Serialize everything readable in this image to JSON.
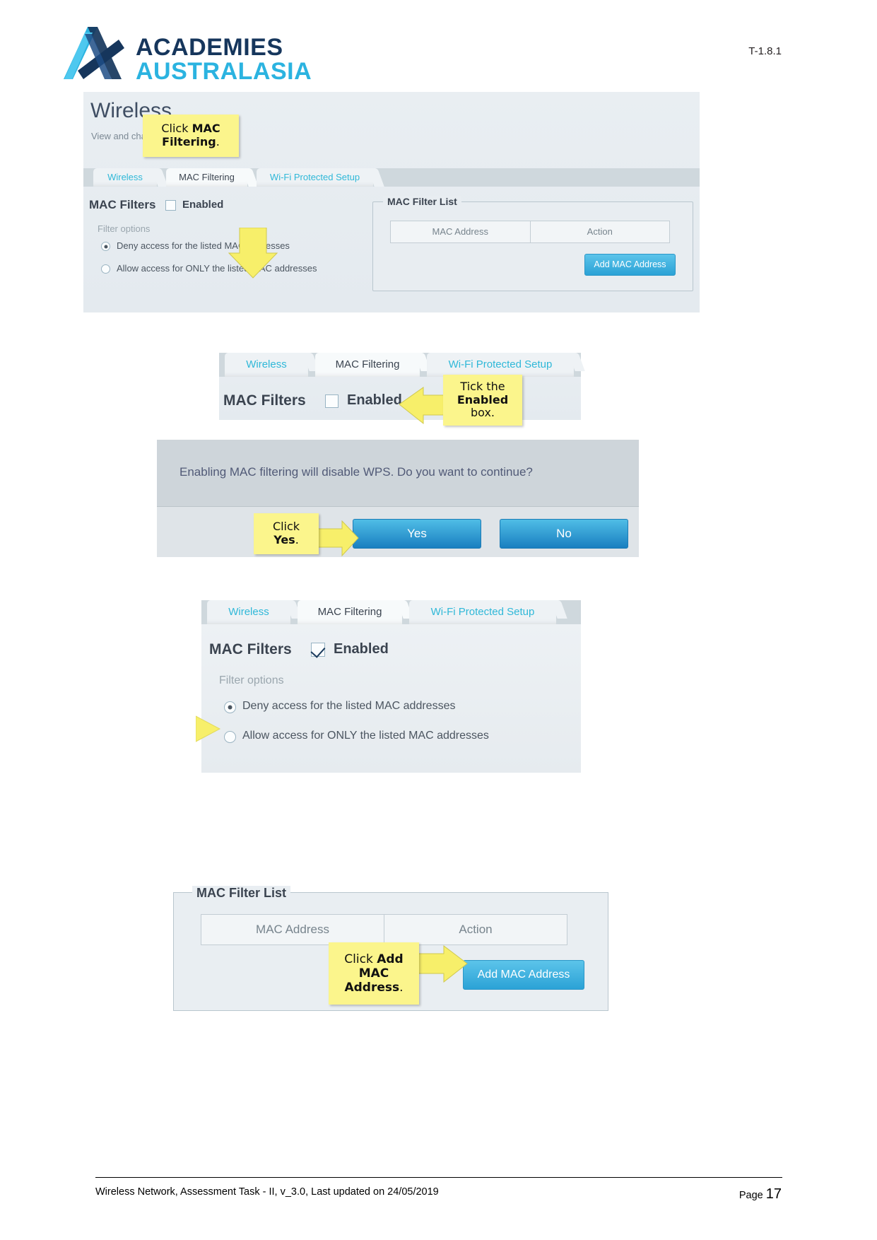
{
  "header": {
    "logo_line1": "ACADEMIES",
    "logo_line2": "AUSTRALASIA",
    "doc_code": "T-1.8.1",
    "logo_icon": "academies-australasia-a-logo",
    "colors": {
      "light_blue": "#2bb3e0",
      "navy": "#16365c"
    }
  },
  "panel1": {
    "page_title": "Wireless",
    "page_subtitle": "View and cha",
    "tabs": [
      {
        "label": "Wireless",
        "active": false
      },
      {
        "label": "MAC Filtering",
        "active": true
      },
      {
        "label": "Wi-Fi Protected Setup",
        "active": false
      }
    ],
    "mac_filters_label": "MAC Filters",
    "enabled_label": "Enabled",
    "enabled_checked": false,
    "filter_options_label": "Filter options",
    "options": [
      {
        "label": "Deny access for the listed MAC addresses",
        "selected": true
      },
      {
        "label": "Allow access for ONLY the listed MAC addresses",
        "selected": false
      }
    ],
    "list_legend": "MAC Filter List",
    "table_headers": [
      "MAC Address",
      "Action"
    ],
    "add_button": "Add MAC Address",
    "callout": {
      "line1_plain": "Click ",
      "line1_bold": "MAC",
      "line2_bold": "Filtering",
      "line2_plain": "."
    }
  },
  "panel2": {
    "tabs": [
      {
        "label": "Wireless",
        "active": false
      },
      {
        "label": "MAC Filtering",
        "active": true
      },
      {
        "label": "Wi-Fi Protected Setup",
        "active": false
      }
    ],
    "mac_filters_label": "MAC Filters",
    "enabled_label": "Enabled",
    "enabled_checked": false,
    "callout": {
      "line1": "Tick the",
      "line2_bold": "Enabled",
      "line3": "box."
    }
  },
  "panel3": {
    "message": "Enabling MAC filtering will disable WPS. Do you want to continue?",
    "yes_label": "Yes",
    "no_label": "No",
    "callout": {
      "line1": "Click",
      "line2_bold": "Yes",
      "line2_plain": "."
    }
  },
  "panel4": {
    "tabs": [
      {
        "label": "Wireless",
        "active": false
      },
      {
        "label": "MAC Filtering",
        "active": true
      },
      {
        "label": "Wi-Fi Protected Setup",
        "active": false
      }
    ],
    "mac_filters_label": "MAC Filters",
    "enabled_label": "Enabled",
    "enabled_checked": true,
    "filter_options_label": "Filter options",
    "options": [
      {
        "label": "Deny access for the listed MAC addresses",
        "selected": true
      },
      {
        "label": "Allow access for ONLY the listed MAC addresses",
        "selected": false
      }
    ]
  },
  "panel5": {
    "list_legend": "MAC Filter List",
    "table_headers": [
      "MAC Address",
      "Action"
    ],
    "add_button": "Add MAC Address",
    "callout": {
      "line1_plain": "Click ",
      "line1_bold": "Add",
      "line2_bold": "MAC",
      "line3_bold": "Address",
      "line3_plain": "."
    }
  },
  "footer": {
    "left": "Wireless Network, Assessment Task - II, v_3.0, Last updated on 24/05/2019",
    "page_word": "Page ",
    "page_number": "17"
  }
}
